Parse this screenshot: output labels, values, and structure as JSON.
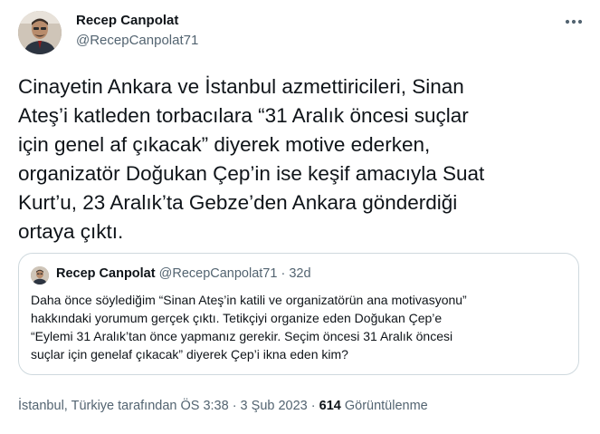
{
  "tweet": {
    "author_name": "Recep Canpolat",
    "author_handle": "@RecepCanpolat71",
    "more_icon": "more-horizontal-icon",
    "text": "Cinayetin Ankara ve İstanbul azmettiricileri, Sinan\nAteş’i katleden torbacılara “31 Aralık öncesi suçlar\niçin genel af çıkacak” diyerek motive ederken,\norganizatör Doğukan Çep’in ise keşif amacıyla Suat\nKurt’u, 23 Aralık’ta Gebze’den Ankara gönderdiği\nortaya çıktı."
  },
  "quoted": {
    "author_name": "Recep Canpolat",
    "author_handle": "@RecepCanpolat71",
    "separator": "·",
    "age": "32d",
    "text": "Daha önce söylediğim “Sinan Ateş’in katili ve organizatörün ana motivasyonu”\nhakkındaki yorumum gerçek çıktı. Tetikçiyi organize eden Doğukan Çep’e\n“Eylemi 31 Aralık’tan önce yapmanız gerekir. Seçim öncesi 31 Aralık öncesi\nsuçlar için genelaf çıkacak” diyerek Çep’i ikna eden kim?"
  },
  "meta": {
    "location_time": "İstanbul, Türkiye tarafından ÖS 3:38 · 3 Şub 2023 · ",
    "views_count": "614",
    "views_label": " Görüntülenme"
  },
  "colors": {
    "text": "#0f1419",
    "secondary": "#536471",
    "border": "#cfd9de",
    "background": "#ffffff"
  }
}
